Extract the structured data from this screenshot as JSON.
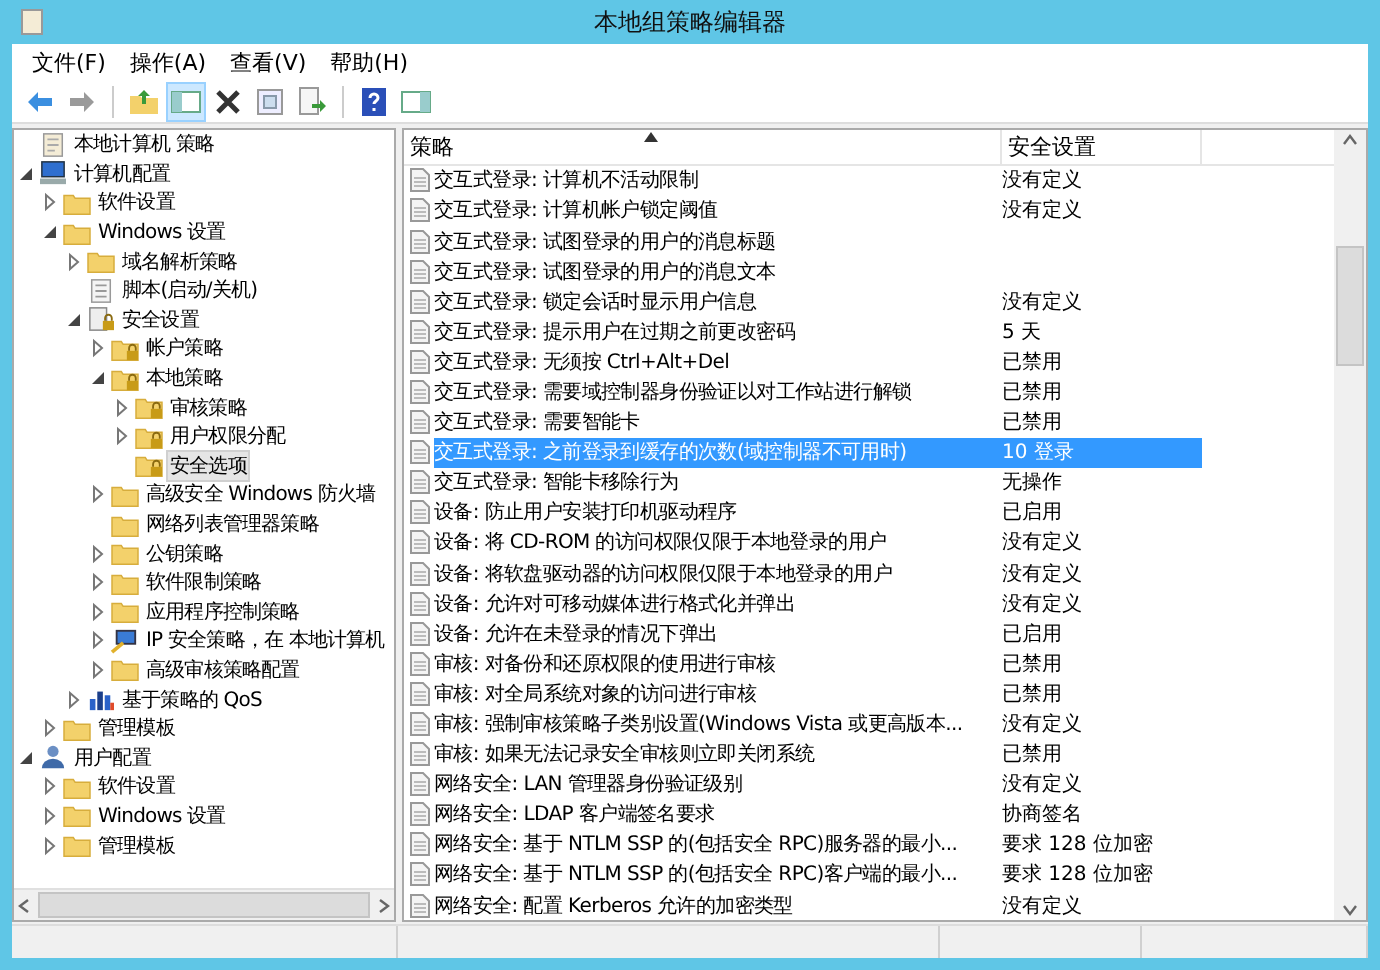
{
  "window": {
    "title": "本地组策略编辑器"
  },
  "menu": [
    {
      "label": "文件(F)"
    },
    {
      "label": "操作(A)"
    },
    {
      "label": "查看(V)"
    },
    {
      "label": "帮助(H)"
    }
  ],
  "tree": [
    {
      "label": "本地计算机 策略",
      "kind": "policy",
      "selected": false
    },
    {
      "label": "计算机配置",
      "kind": "computer",
      "expanded": true,
      "selected": false,
      "children": [
        {
          "label": "软件设置",
          "kind": "folder",
          "expanded": false,
          "selected": false
        },
        {
          "label": "Windows 设置",
          "kind": "folder",
          "expanded": true,
          "selected": false,
          "children": [
            {
              "label": "域名解析策略",
              "kind": "folder",
              "expanded": false,
              "selected": false
            },
            {
              "label": "脚本(启动/关机)",
              "kind": "script",
              "selected": false
            },
            {
              "label": "安全设置",
              "kind": "secure",
              "expanded": true,
              "selected": false,
              "children": [
                {
                  "label": "帐户策略",
                  "kind": "lockfolder",
                  "expanded": false,
                  "selected": false
                },
                {
                  "label": "本地策略",
                  "kind": "lockfolder",
                  "expanded": true,
                  "selected": false,
                  "children": [
                    {
                      "label": "审核策略",
                      "kind": "lockfolder",
                      "expanded": false,
                      "selected": false
                    },
                    {
                      "label": "用户权限分配",
                      "kind": "lockfolder",
                      "expanded": false,
                      "selected": false
                    },
                    {
                      "label": "安全选项",
                      "kind": "lockfolder",
                      "selected": true
                    }
                  ]
                },
                {
                  "label": "高级安全 Windows 防火墙",
                  "kind": "folder",
                  "expanded": false,
                  "selected": false
                },
                {
                  "label": "网络列表管理器策略",
                  "kind": "folder",
                  "selected": false
                },
                {
                  "label": "公钥策略",
                  "kind": "folder",
                  "expanded": false,
                  "selected": false
                },
                {
                  "label": "软件限制策略",
                  "kind": "folder",
                  "expanded": false,
                  "selected": false
                },
                {
                  "label": "应用程序控制策略",
                  "kind": "folder",
                  "expanded": false,
                  "selected": false
                },
                {
                  "label": "IP 安全策略，在 本地计算机",
                  "kind": "ip",
                  "expanded": false,
                  "selected": false
                },
                {
                  "label": "高级审核策略配置",
                  "kind": "folder",
                  "expanded": false,
                  "selected": false
                }
              ]
            },
            {
              "label": "基于策略的 QoS",
              "kind": "chart",
              "expanded": false,
              "selected": false
            }
          ]
        },
        {
          "label": "管理模板",
          "kind": "folder",
          "expanded": false,
          "selected": false
        }
      ]
    },
    {
      "label": "用户配置",
      "kind": "user",
      "expanded": true,
      "selected": false,
      "children": [
        {
          "label": "软件设置",
          "kind": "folder",
          "expanded": false,
          "selected": false
        },
        {
          "label": "Windows 设置",
          "kind": "folder",
          "expanded": false,
          "selected": false
        },
        {
          "label": "管理模板",
          "kind": "folder",
          "expanded": false,
          "selected": false
        }
      ]
    }
  ],
  "table": {
    "columns": [
      {
        "label": "策略",
        "sorted": true
      },
      {
        "label": "安全设置",
        "sorted": false
      }
    ],
    "rows": [
      {
        "policy": "交互式登录: 计算机不活动限制",
        "setting": "没有定义",
        "selected": false
      },
      {
        "policy": "交互式登录: 计算机帐户锁定阈值",
        "setting": "没有定义",
        "selected": false
      },
      {
        "policy": "交互式登录: 试图登录的用户的消息标题",
        "selected": false
      },
      {
        "policy": "交互式登录: 试图登录的用户的消息文本",
        "selected": false
      },
      {
        "policy": "交互式登录: 锁定会话时显示用户信息",
        "setting": "没有定义",
        "selected": false
      },
      {
        "policy": "交互式登录: 提示用户在过期之前更改密码",
        "setting": "5 天",
        "selected": false
      },
      {
        "policy": "交互式登录: 无须按 Ctrl+Alt+Del",
        "setting": "已禁用",
        "selected": false
      },
      {
        "policy": "交互式登录: 需要域控制器身份验证以对工作站进行解锁",
        "setting": "已禁用",
        "selected": false
      },
      {
        "policy": "交互式登录: 需要智能卡",
        "setting": "已禁用",
        "selected": false
      },
      {
        "policy": "交互式登录: 之前登录到缓存的次数(域控制器不可用时)",
        "setting": "10 登录",
        "selected": true
      },
      {
        "policy": "交互式登录: 智能卡移除行为",
        "setting": "无操作",
        "selected": false
      },
      {
        "policy": "设备: 防止用户安装打印机驱动程序",
        "setting": "已启用",
        "selected": false
      },
      {
        "policy": "设备: 将 CD-ROM 的访问权限仅限于本地登录的用户",
        "setting": "没有定义",
        "selected": false
      },
      {
        "policy": "设备: 将软盘驱动器的访问权限仅限于本地登录的用户",
        "setting": "没有定义",
        "selected": false
      },
      {
        "policy": "设备: 允许对可移动媒体进行格式化并弹出",
        "setting": "没有定义",
        "selected": false
      },
      {
        "policy": "设备: 允许在未登录的情况下弹出",
        "setting": "已启用",
        "selected": false
      },
      {
        "policy": "审核: 对备份和还原权限的使用进行审核",
        "setting": "已禁用",
        "selected": false
      },
      {
        "policy": "审核: 对全局系统对象的访问进行审核",
        "setting": "已禁用",
        "selected": false
      },
      {
        "policy": "审核: 强制审核策略子类别设置(Windows Vista 或更高版本...",
        "setting": "没有定义",
        "selected": false
      },
      {
        "policy": "审核: 如果无法记录安全审核则立即关闭系统",
        "setting": "已禁用",
        "selected": false
      },
      {
        "policy": "网络安全: LAN 管理器身份验证级别",
        "setting": "没有定义",
        "selected": false
      },
      {
        "policy": "网络安全: LDAP 客户端签名要求",
        "setting": "协商签名",
        "selected": false
      },
      {
        "policy": "网络安全: 基于 NTLM SSP 的(包括安全 RPC)服务器的最小...",
        "setting": "要求 128 位加密",
        "selected": false
      },
      {
        "policy": "网络安全: 基于 NTLM SSP 的(包括安全 RPC)客户端的最小...",
        "setting": "要求 128 位加密",
        "selected": false
      },
      {
        "policy": "网络安全: 配置 Kerberos 允许的加密类型",
        "setting": "没有定义",
        "selected": false
      }
    ]
  }
}
